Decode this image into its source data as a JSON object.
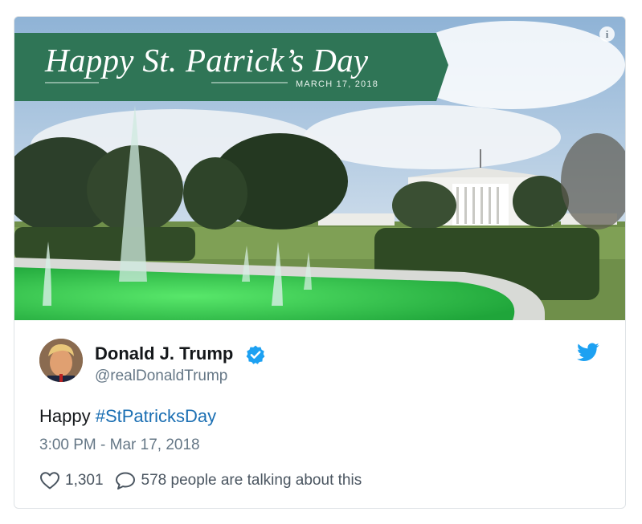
{
  "media": {
    "banner_title": "Happy St. Patrick’s Day",
    "banner_date": "MARCH 17, 2018",
    "info_icon": "info-icon",
    "colors": {
      "banner": "#2f7556",
      "water": "#2fd24f"
    }
  },
  "tweet": {
    "author_name": "Donald J. Trump",
    "handle": "@realDonaldTrump",
    "text_prefix": "Happy ",
    "hashtag": "#StPatricksDay",
    "timestamp": "3:00 PM - Mar 17, 2018",
    "likes": "1,301",
    "talking": "578 people are talking about this",
    "colors": {
      "link": "#1b6fb3",
      "verified": "#1da1f2",
      "twitter_bird": "#1da1f2"
    }
  }
}
